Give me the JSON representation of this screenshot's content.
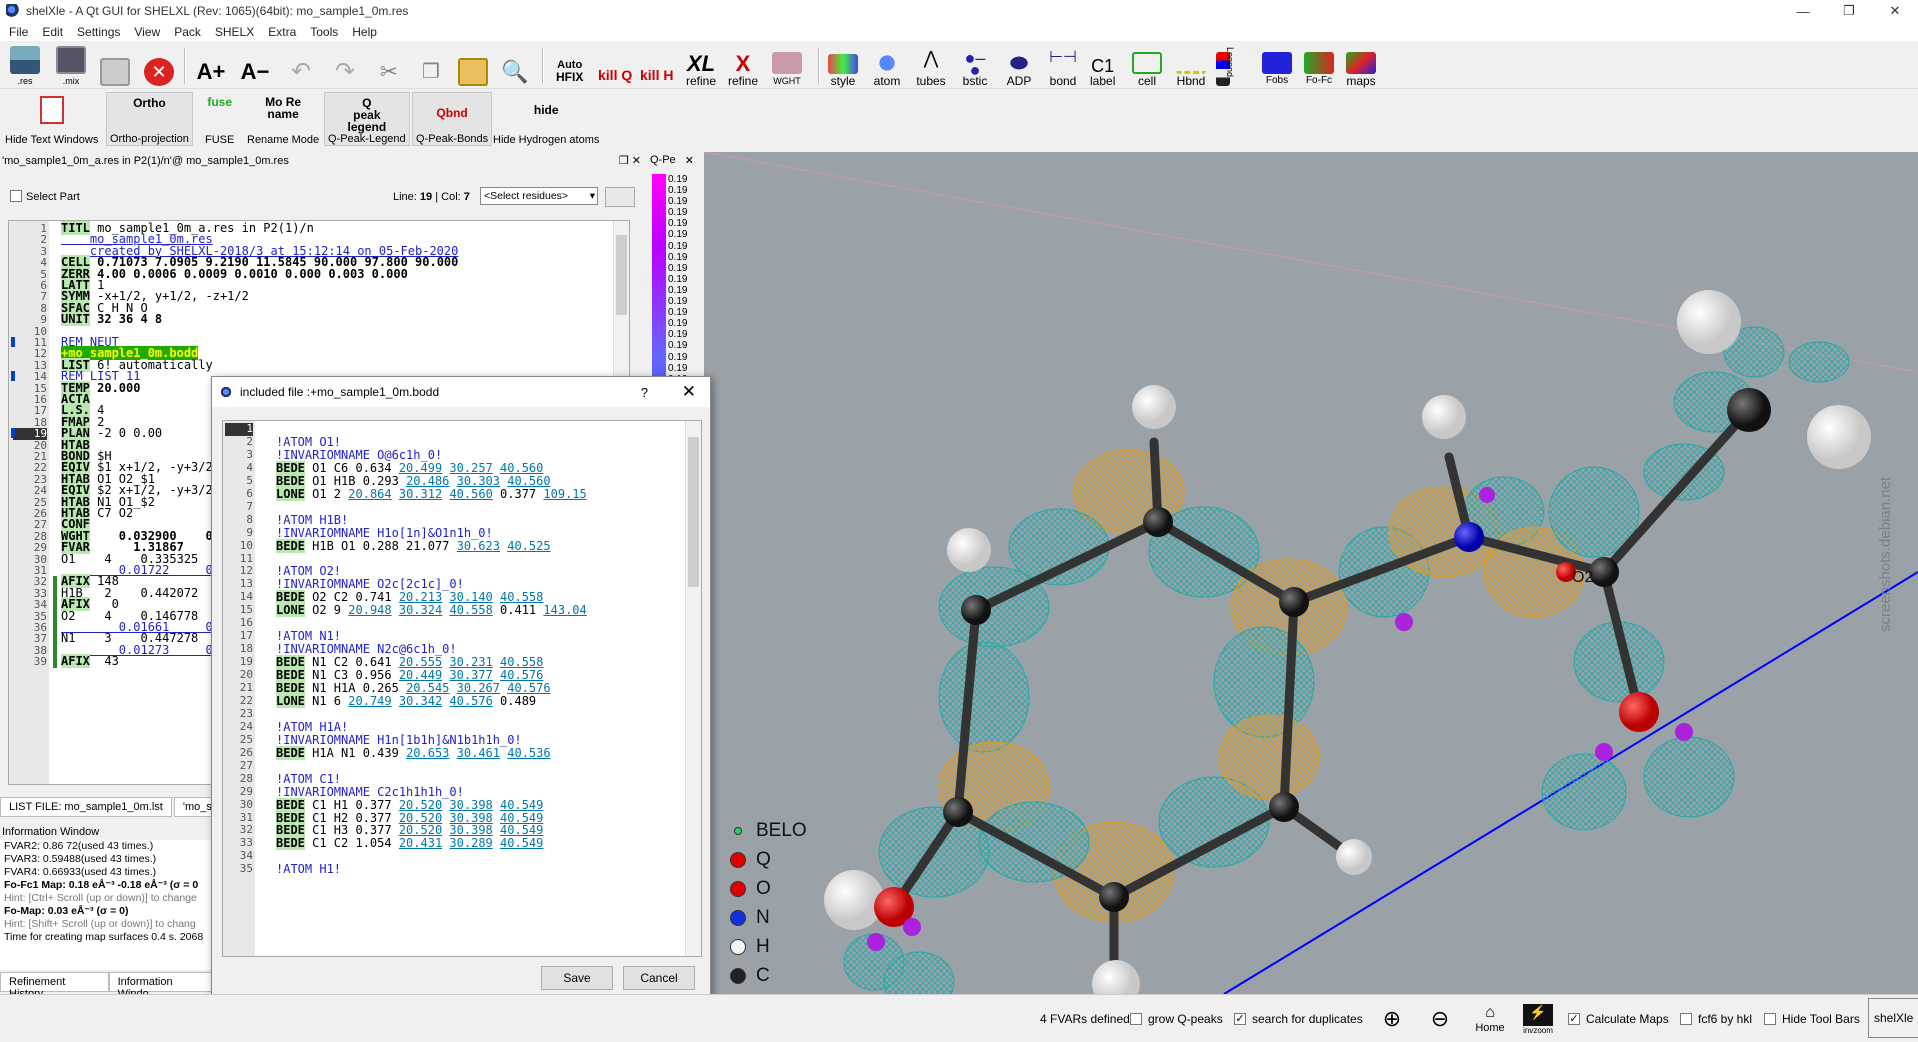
{
  "window": {
    "title": "shelXle - A Qt GUI for SHELXL (Rev: 1065)(64bit): mo_sample1_0m.res",
    "minimize": "—",
    "restore": "❐",
    "close": "✕"
  },
  "menu": [
    "File",
    "Edit",
    "Settings",
    "View",
    "Pack",
    "SHELX",
    "Extra",
    "Tools",
    "Help"
  ],
  "toolbar": {
    "res_label": ".res",
    "mix_label": ".mix",
    "hfix_top": "Auto",
    "hfix": "HFIX",
    "kill_q": "kill Q",
    "kill_h": "kill H",
    "xl": "XL",
    "refine": "refine",
    "xl_refine": "refine",
    "wght": "WGHT",
    "style": "style",
    "atom": "atom",
    "tubes": "tubes",
    "bstic": "bstic",
    "adp": "ADP",
    "bond": "bond",
    "c1": "C1",
    "label": "label",
    "cell": "cell",
    "hbnd": "Hbnd",
    "legend": "Legend",
    "fobs": "Fobs",
    "fofc": "Fo-Fc",
    "maps": "maps"
  },
  "toolbar2": [
    {
      "icon": "",
      "label": "Hide Text Windows"
    },
    {
      "icon": "Ortho",
      "label": "Ortho-projection"
    },
    {
      "icon": "fuse",
      "label": "FUSE"
    },
    {
      "icon": "Mo Re name",
      "label": "Rename Mode"
    },
    {
      "icon": "Q peak legend",
      "label": "Q-Peak-Legend"
    },
    {
      "icon": "Qbnd",
      "label": "Q-Peak-Bonds"
    },
    {
      "icon": "hide",
      "label": "Hide Hydrogen atoms"
    }
  ],
  "editor": {
    "header": "'mo_sample1_0m_a.res in P2(1)/n'@ mo_sample1_0m.res",
    "select_part": "Select Part",
    "line_label": "Line:",
    "line": "19",
    "col_label": "Col:",
    "col": "7",
    "residue_select": "<Select residues>",
    "lines": [
      [
        "1",
        "TITL mo_sample1_0m_a.res in P2(1)/n"
      ],
      [
        "2",
        "    mo_sample1_0m.res"
      ],
      [
        "3",
        "    created by SHELXL-2018/3 at 15:12:14 on 05-Feb-2020"
      ],
      [
        "4",
        "CELL 0.71073 7.0905 9.2190 11.5845 90.000 97.800 90.000"
      ],
      [
        "5",
        "ZERR 4.00 0.0006 0.0009 0.0010 0.000 0.003 0.000"
      ],
      [
        "6",
        "LATT 1"
      ],
      [
        "7",
        "SYMM -x+1/2, y+1/2, -z+1/2"
      ],
      [
        "8",
        "SFAC C H N O"
      ],
      [
        "9",
        "UNIT 32 36 4 8"
      ],
      [
        "10",
        ""
      ],
      [
        "11",
        "REM NEUT"
      ],
      [
        "12",
        "+mo_sample1_0m.bodd"
      ],
      [
        "13",
        "LIST 6! automatically"
      ],
      [
        "14",
        "REM LIST 11"
      ],
      [
        "15",
        "TEMP 20.000"
      ],
      [
        "16",
        "ACTA"
      ],
      [
        "17",
        "L.S. 4"
      ],
      [
        "18",
        "FMAP 2"
      ],
      [
        "19",
        "PLAN -2 0 0.00"
      ],
      [
        "20",
        "HTAB"
      ],
      [
        "21",
        "BOND $H"
      ],
      [
        "22",
        "EQIV $1 x+1/2, -y+3/2"
      ],
      [
        "23",
        "HTAB O1 O2_$1"
      ],
      [
        "24",
        "EQIV $2 x+1/2, -y+3/2"
      ],
      [
        "25",
        "HTAB N1 O1_$2"
      ],
      [
        "26",
        "HTAB C7 O2"
      ],
      [
        "27",
        "CONF"
      ],
      [
        "28",
        "WGHT    0.032900    0"
      ],
      [
        "29",
        "FVAR      1.31867"
      ],
      [
        "30",
        "O1    4    0.335325   0"
      ],
      [
        "31",
        "        0.01722     0"
      ],
      [
        "32",
        "AFIX 148"
      ],
      [
        "33",
        "H1B   2    0.442072"
      ],
      [
        "34",
        "AFIX   0"
      ],
      [
        "35",
        "O2    4    0.146778"
      ],
      [
        "36",
        "        0.01661     0"
      ],
      [
        "37",
        "N1    3    0.447278"
      ],
      [
        "38",
        "        0.01273     0"
      ],
      [
        "39",
        "AFIX  43"
      ]
    ]
  },
  "qpeak": {
    "label": "Q-Pe",
    "close": "✕",
    "values": [
      "0.19",
      "0.19",
      "0.19",
      "0.19",
      "0.19",
      "0.19",
      "0.19",
      "0.19",
      "0.19",
      "0.19",
      "0.19",
      "0.19",
      "0.19",
      "0.19",
      "0.19",
      "0.19",
      "0.19",
      "0.19",
      "0.19",
      "0.19",
      "0.19",
      "0.19",
      "0.19",
      "0.19",
      "0.19",
      "0.19",
      "0.19",
      "0.19",
      "0.19",
      "0.19",
      "0.19",
      "0.19",
      "0.19",
      "0.19",
      "0.19",
      "0.19",
      "0.19",
      "0.19",
      "0.19",
      "0.19",
      "0.19",
      "0.19",
      "0.19",
      "0.19",
      "0.19",
      "0.19",
      "0.19",
      "0.19",
      "0.19",
      "0.19",
      "0.19",
      "0.19",
      "0.19",
      "0.19"
    ]
  },
  "viewport": {
    "atom_label": "O2",
    "watermark": "screenshots.debian.net",
    "legend": [
      {
        "label": "BELO",
        "color": "#2ecc71"
      },
      {
        "label": "Q",
        "color": "#e00000"
      },
      {
        "label": "O",
        "color": "#e00000"
      },
      {
        "label": "N",
        "color": "#1030e0"
      },
      {
        "label": "H",
        "color": "#f4f4f4"
      },
      {
        "label": "C",
        "color": "#222222"
      }
    ]
  },
  "list_tabs": [
    "LIST FILE: mo_sample1_0m.lst",
    "'mo_sa"
  ],
  "info": {
    "header": "Information Window",
    "lines": [
      {
        "t": "FVAR2: 0.86 72(used 43 times.)"
      },
      {
        "t": "FVAR3: 0.59488(used 43 times.)"
      },
      {
        "t": "FVAR4: 0.66933(used 43 times.)"
      },
      {
        "t": ""
      },
      {
        "t": "Fo-Fc1 Map: 0.18 eÅ⁻³  -0.18 eÅ⁻³ (σ = 0"
      },
      {
        "t": "Hint:  [Ctrl+ Scroll (up or down)] to change"
      },
      {
        "t": "Fo-Map: 0.03 eÅ⁻³ (σ =    0)"
      },
      {
        "t": "Hint:  [Shift+ Scroll (up or down)] to chang"
      },
      {
        "t": "Time for creating map surfaces 0.4 s. 2068"
      }
    ]
  },
  "bottom_tabs": [
    "Refinement History",
    "Information Windo"
  ],
  "dialog": {
    "title": "included file :+mo_sample1_0m.bodd",
    "help": "?",
    "close": "✕",
    "save": "Save",
    "cancel": "Cancel",
    "lines": [
      [
        "1",
        ""
      ],
      [
        "2",
        "!ATOM O1!"
      ],
      [
        "3",
        "!INVARIOMNAME O@6c1h_0!"
      ],
      [
        "4",
        "BEDE O1 C6 0.634 20.499 30.257 40.560"
      ],
      [
        "5",
        "BEDE O1 H1B 0.293 20.486 30.303 40.560"
      ],
      [
        "6",
        "LONE O1 2 20.864 30.312 40.560 0.377 109.15"
      ],
      [
        "7",
        ""
      ],
      [
        "8",
        "!ATOM H1B!"
      ],
      [
        "9",
        "!INVARIOMNAME H1o[1n]&O1n1h_0!"
      ],
      [
        "10",
        "BEDE H1B O1 0.288 21.077 30.623 40.525"
      ],
      [
        "11",
        ""
      ],
      [
        "12",
        "!ATOM O2!"
      ],
      [
        "13",
        "!INVARIOMNAME O2c[2c1c]_0!"
      ],
      [
        "14",
        "BEDE O2 C2 0.741 20.213 30.140 40.558"
      ],
      [
        "15",
        "LONE O2 9 20.948 30.324 40.558 0.411 143.04"
      ],
      [
        "16",
        ""
      ],
      [
        "17",
        "!ATOM N1!"
      ],
      [
        "18",
        "!INVARIOMNAME N2c@6c1h_0!"
      ],
      [
        "19",
        "BEDE N1 C2 0.641 20.555 30.231 40.558"
      ],
      [
        "20",
        "BEDE N1 C3 0.956 20.449 30.377 40.576"
      ],
      [
        "21",
        "BEDE N1 H1A 0.265 20.545 30.267 40.576"
      ],
      [
        "22",
        "LONE N1 6 20.749 30.342 40.576 0.489"
      ],
      [
        "23",
        ""
      ],
      [
        "24",
        "!ATOM H1A!"
      ],
      [
        "25",
        "!INVARIOMNAME H1n[1b1h]&N1b1h1h_0!"
      ],
      [
        "26",
        "BEDE H1A N1 0.439 20.653 30.461 40.536"
      ],
      [
        "27",
        ""
      ],
      [
        "28",
        "!ATOM C1!"
      ],
      [
        "29",
        "!INVARIOMNAME C2c1h1h1h_0!"
      ],
      [
        "30",
        "BEDE C1 H1 0.377 20.520 30.398 40.549"
      ],
      [
        "31",
        "BEDE C1 H2 0.377 20.520 30.398 40.549"
      ],
      [
        "32",
        "BEDE C1 H3 0.377 20.520 30.398 40.549"
      ],
      [
        "33",
        "BEDE C1 C2 1.054 20.431 30.289 40.549"
      ],
      [
        "34",
        ""
      ],
      [
        "35",
        "!ATOM H1!"
      ]
    ]
  },
  "status": {
    "fvars": "4 FVARs defined",
    "grow_q": "grow Q-peaks",
    "search_dup": "search for duplicates",
    "home": "Home",
    "invzoom": "invzoom",
    "calc_maps": "Calculate Maps",
    "fcf6": "fcf6 by hkl",
    "hide_toolbars": "Hide Tool Bars",
    "shelxle": "shelXle"
  }
}
